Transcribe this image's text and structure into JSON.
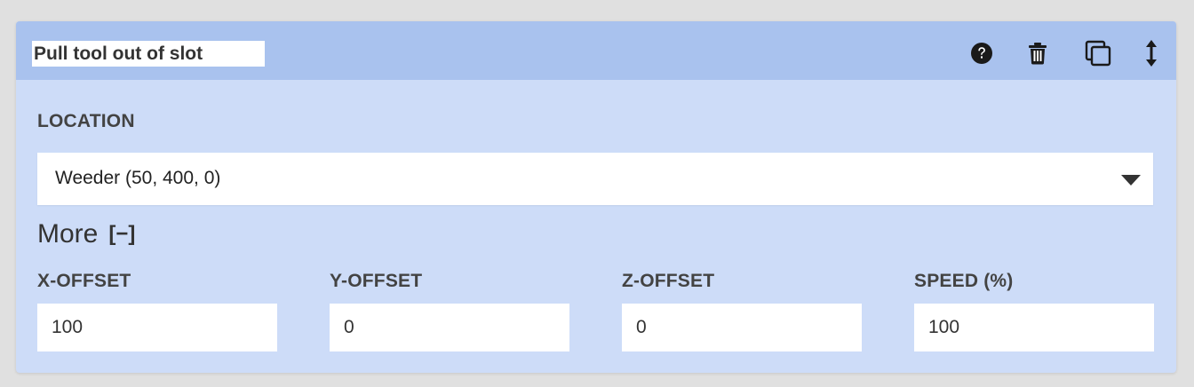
{
  "step": {
    "name": "Pull tool out of slot"
  },
  "header_icons": {
    "help": "question-circle-icon",
    "delete": "trash-icon",
    "duplicate": "copy-icon",
    "reorder": "vertical-arrows-icon"
  },
  "location": {
    "label": "LOCATION",
    "selected": "Weeder (50, 400, 0)"
  },
  "more": {
    "label": "More",
    "toggle_symbol": "[−]"
  },
  "offsets": {
    "x": {
      "label": "X-OFFSET",
      "value": "100"
    },
    "y": {
      "label": "Y-OFFSET",
      "value": "0"
    },
    "z": {
      "label": "Z-OFFSET",
      "value": "0"
    },
    "speed": {
      "label": "SPEED (%)",
      "value": "100"
    }
  },
  "colors": {
    "header_bg": "#a9c2ee",
    "body_bg": "#cddcf8",
    "page_bg": "#e0e0e0"
  }
}
